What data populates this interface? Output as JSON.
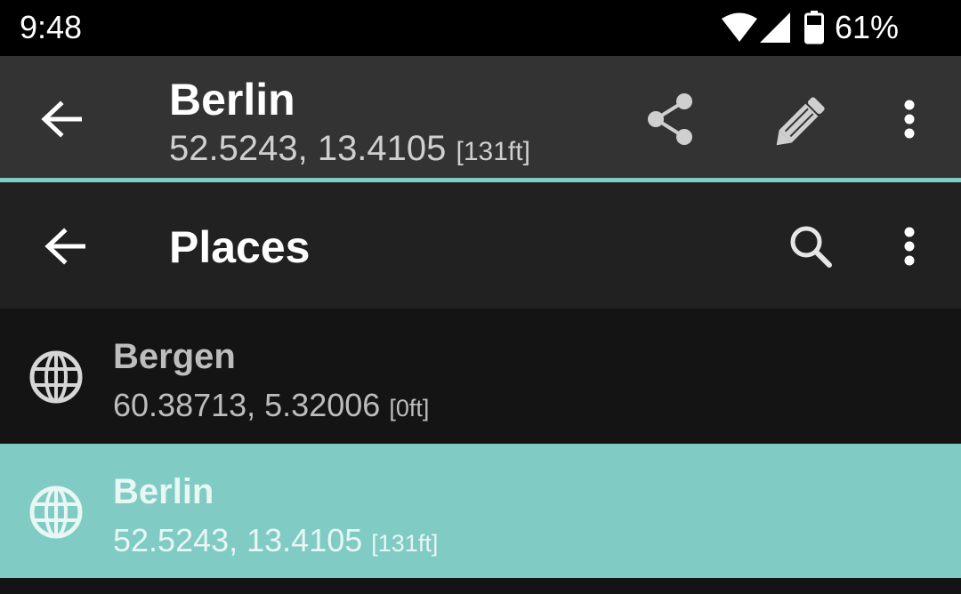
{
  "status_bar": {
    "time": "9:48",
    "battery_percent": "61%",
    "icons": [
      "wifi-icon",
      "signal-icon",
      "battery-icon"
    ]
  },
  "detail_bar": {
    "title": "Berlin",
    "coords": "52.5243, 13.4105",
    "elevation": "[131ft]",
    "icons": [
      "back-arrow-icon",
      "share-icon",
      "pencil-icon",
      "overflow-menu-icon"
    ]
  },
  "places_bar": {
    "title": "Places",
    "icons": [
      "back-arrow-icon",
      "search-icon",
      "overflow-menu-icon"
    ]
  },
  "places": [
    {
      "name": "Bergen",
      "coords": "60.38713, 5.32006",
      "elevation": "[0ft]",
      "selected": false
    },
    {
      "name": "Berlin",
      "coords": "52.5243, 13.4105",
      "elevation": "[131ft]",
      "selected": true
    }
  ],
  "colors": {
    "accent": "#80cbc4",
    "toolbar": "#333333",
    "second_toolbar": "#212121",
    "background": "#141414"
  }
}
